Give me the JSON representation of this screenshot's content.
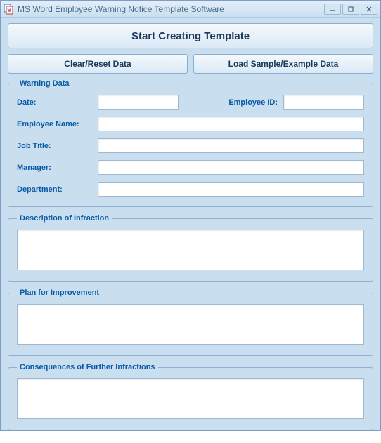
{
  "window": {
    "title": "MS Word Employee Warning Notice Template Software"
  },
  "buttons": {
    "start": "Start Creating Template",
    "clear": "Clear/Reset Data",
    "load": "Load Sample/Example Data"
  },
  "warning_data": {
    "legend": "Warning Data",
    "labels": {
      "date": "Date:",
      "employee_id": "Employee ID:",
      "employee_name": "Employee Name:",
      "job_title": "Job Title:",
      "manager": "Manager:",
      "department": "Department:"
    },
    "values": {
      "date": "",
      "employee_id": "",
      "employee_name": "",
      "job_title": "",
      "manager": "",
      "department": ""
    }
  },
  "description": {
    "legend": "Description of Infraction",
    "value": ""
  },
  "plan": {
    "legend": "Plan for Improvement",
    "value": ""
  },
  "consequences": {
    "legend": "Consequences of Further Infractions",
    "value": ""
  }
}
